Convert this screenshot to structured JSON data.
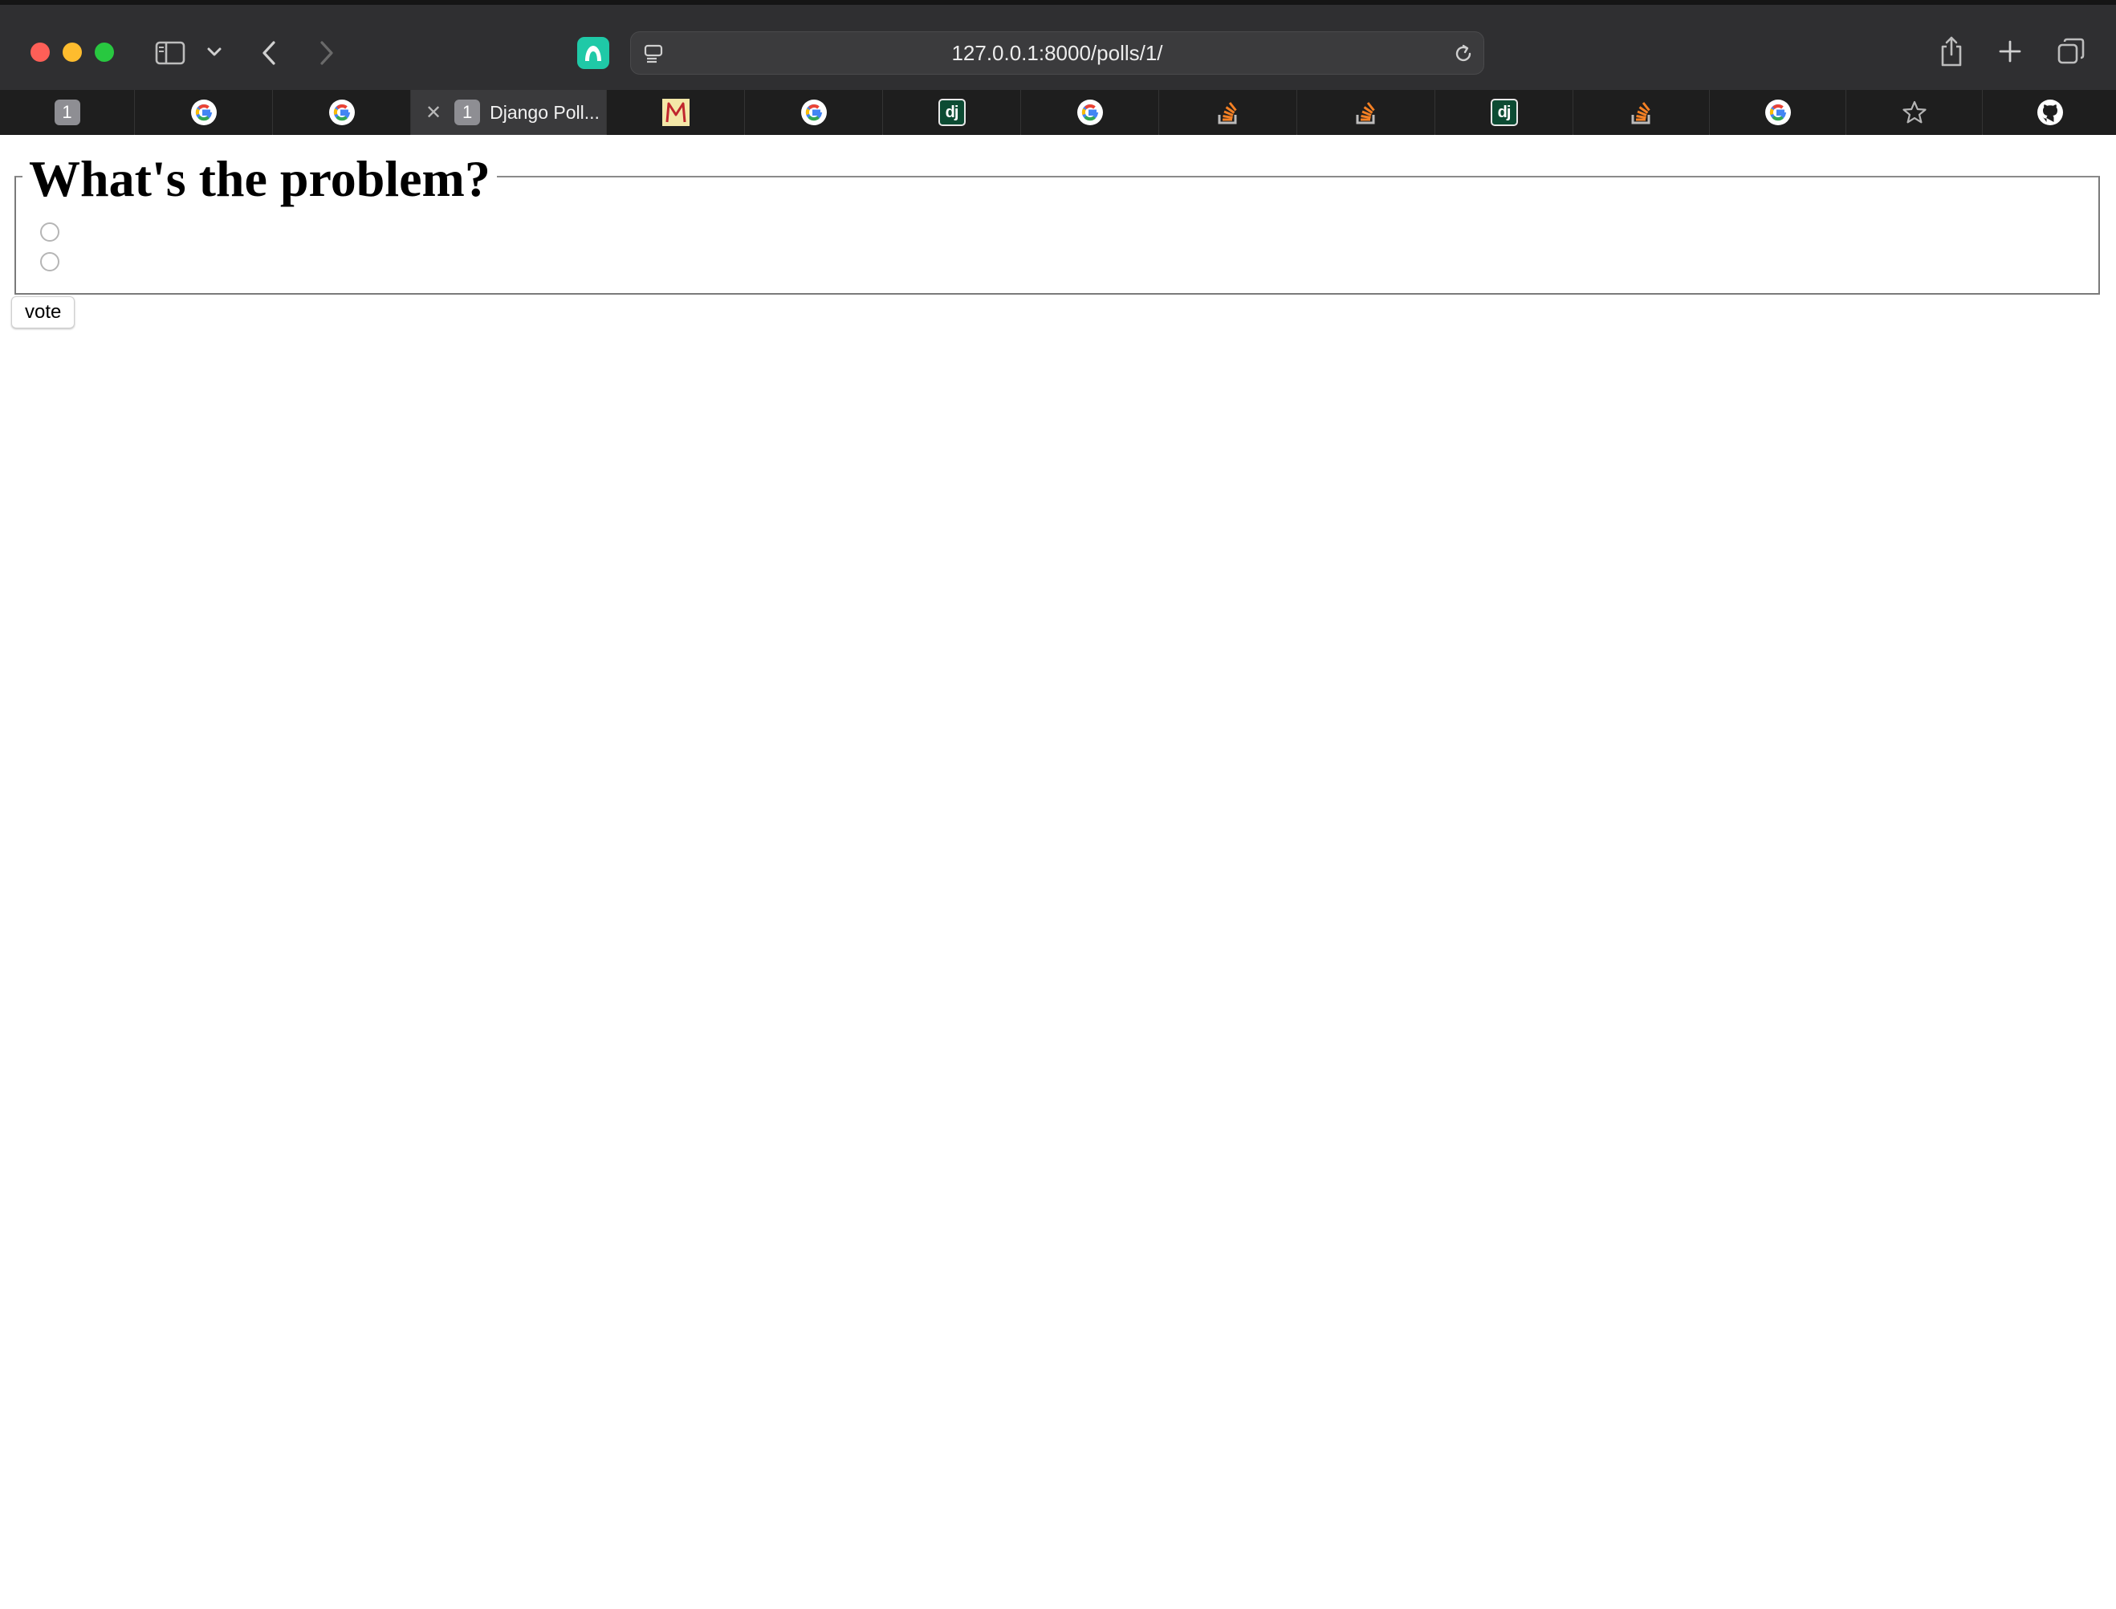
{
  "browser": {
    "url": "127.0.0.1:8000/polls/1/",
    "colors": {
      "toolbar": "#2f2f31",
      "tabstrip": "#1e1e1e",
      "active_tab": "#3a3a3c",
      "extension": "#1fc9a7"
    }
  },
  "tabs": [
    {
      "favicon": "number-badge-icon",
      "badge": "1"
    },
    {
      "favicon": "google-icon"
    },
    {
      "favicon": "google-icon"
    },
    {
      "favicon": "number-badge-icon",
      "badge": "1",
      "title": "Django Poll...",
      "active": true
    },
    {
      "favicon": "gmail-m-icon"
    },
    {
      "favicon": "google-icon"
    },
    {
      "favicon": "django-icon",
      "badge": "dj"
    },
    {
      "favicon": "google-icon"
    },
    {
      "favicon": "stackoverflow-icon"
    },
    {
      "favicon": "stackoverflow-icon"
    },
    {
      "favicon": "django-icon",
      "badge": "dj"
    },
    {
      "favicon": "stackoverflow-icon"
    },
    {
      "favicon": "google-icon"
    },
    {
      "favicon": "star-icon"
    },
    {
      "favicon": "github-icon"
    }
  ],
  "poll": {
    "question": "What's the problem?",
    "choices": [
      "",
      ""
    ],
    "submit_label": "vote"
  }
}
